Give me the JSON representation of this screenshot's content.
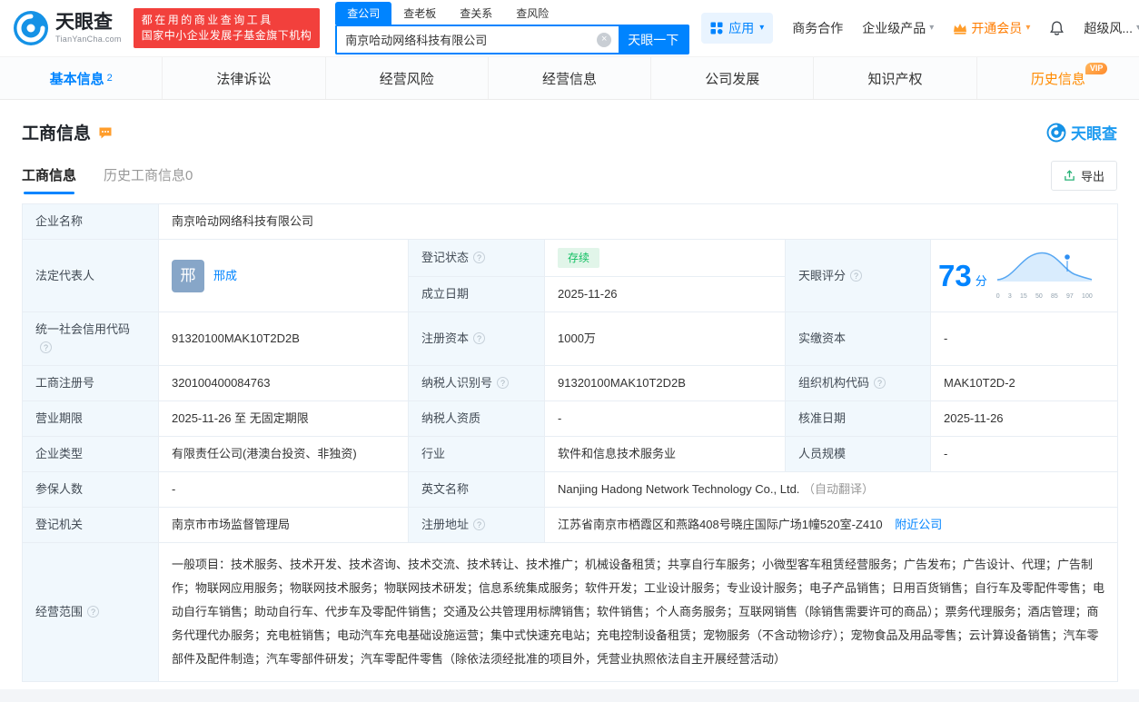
{
  "icons": {
    "caret": "▾",
    "help": "?",
    "clear": "×"
  },
  "header": {
    "logo_title": "天眼查",
    "logo_domain": "TianYanCha.com",
    "badge_line1": "都在用的商业查询工具",
    "badge_line2": "国家中小企业发展子基金旗下机构",
    "search_tabs": [
      {
        "label": "查公司"
      },
      {
        "label": "查老板"
      },
      {
        "label": "查关系"
      },
      {
        "label": "查风险"
      }
    ],
    "search_value": "南京哈动网络科技有限公司",
    "search_button": "天眼一下",
    "nav": {
      "app": "应用",
      "biz": "商务合作",
      "enterprise": "企业级产品",
      "vip": "开通会员",
      "risk": "超级风..."
    }
  },
  "tabs": [
    {
      "label": "基本信息",
      "count": "2"
    },
    {
      "label": "法律诉讼"
    },
    {
      "label": "经营风险"
    },
    {
      "label": "经营信息"
    },
    {
      "label": "公司发展"
    },
    {
      "label": "知识产权"
    },
    {
      "label": "历史信息",
      "vip": "VIP"
    }
  ],
  "section": {
    "title": "工商信息",
    "watermark": "天眼查",
    "subtab_active": "工商信息",
    "subtab_history": "历史工商信息0",
    "export": "导出"
  },
  "fields": {
    "company_name_label": "企业名称",
    "company_name": "南京哈动网络科技有限公司",
    "legal_rep_label": "法定代表人",
    "legal_rep_avatar": "邢",
    "legal_rep_name": "邢成",
    "reg_status_label": "登记状态",
    "reg_status": "存续",
    "est_date_label": "成立日期",
    "est_date": "2025-11-26",
    "score_label": "天眼评分",
    "score_value": "73",
    "score_unit": "分",
    "credit_code_label": "统一社会信用代码",
    "credit_code": "91320100MAK10T2D2B",
    "reg_capital_label": "注册资本",
    "reg_capital": "1000万",
    "paid_capital_label": "实缴资本",
    "paid_capital": "-",
    "reg_number_label": "工商注册号",
    "reg_number": "320100400084763",
    "taxpayer_id_label": "纳税人识别号",
    "taxpayer_id": "91320100MAK10T2D2B",
    "org_code_label": "组织机构代码",
    "org_code": "MAK10T2D-2",
    "business_term_label": "营业期限",
    "business_term": "2025-11-26 至 无固定期限",
    "taxpayer_quality_label": "纳税人资质",
    "taxpayer_quality": "-",
    "approval_date_label": "核准日期",
    "approval_date": "2025-11-26",
    "company_type_label": "企业类型",
    "company_type": "有限责任公司(港澳台投资、非独资)",
    "industry_label": "行业",
    "industry": "软件和信息技术服务业",
    "staff_size_label": "人员规模",
    "staff_size": "-",
    "insured_label": "参保人数",
    "insured": "-",
    "english_name_label": "英文名称",
    "english_name": "Nanjing Hadong Network Technology Co., Ltd.",
    "english_name_note": "（自动翻译）",
    "reg_authority_label": "登记机关",
    "reg_authority": "南京市市场监督管理局",
    "reg_address_label": "注册地址",
    "reg_address": "江苏省南京市栖霞区和燕路408号晓庄国际广场1幢520室-Z410",
    "nearby_link": "附近公司",
    "business_scope_label": "经营范围",
    "business_scope": "一般项目：技术服务、技术开发、技术咨询、技术交流、技术转让、技术推广；机械设备租赁；共享自行车服务；小微型客车租赁经营服务；广告发布；广告设计、代理；广告制作；物联网应用服务；物联网技术服务；物联网技术研发；信息系统集成服务；软件开发；工业设计服务；专业设计服务；电子产品销售；日用百货销售；自行车及零配件零售；电动自行车销售；助动自行车、代步车及零配件销售；交通及公共管理用标牌销售；软件销售；个人商务服务；互联网销售（除销售需要许可的商品）；票务代理服务；酒店管理；商务代理代办服务；充电桩销售；电动汽车充电基础设施运营；集中式快速充电站；充电控制设备租赁；宠物服务（不含动物诊疗）；宠物食品及用品零售；云计算设备销售；汽车零部件及配件制造；汽车零部件研发；汽车零配件零售（除依法须经批准的项目外，凭营业执照依法自主开展经营活动）"
  },
  "score_chart": {
    "type": "area",
    "value": 73,
    "ticks": [
      "0",
      "3",
      "15",
      "50",
      "85",
      "97",
      "100"
    ]
  },
  "colors": {
    "brand_blue": "#0084ff",
    "orange": "#ff8a00",
    "green": "#10bf61",
    "badge_red": "#f2403c"
  }
}
